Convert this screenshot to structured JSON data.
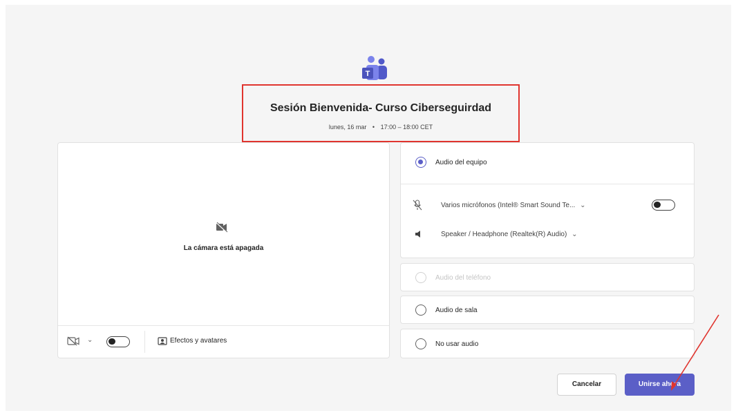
{
  "meeting": {
    "title": "Sesión Bienvenida- Curso Ciberseguirdad",
    "date": "lunes, 16 mar",
    "separator": "•",
    "time": "17:00 – 18:00 CET"
  },
  "video": {
    "camera_off_text": "La cámara está apagada",
    "camera_toggle_on": false,
    "effects_label": "Efectos y avatares"
  },
  "audio": {
    "options": {
      "computer": "Audio del equipo",
      "phone": "Audio del teléfono",
      "room": "Audio de sala",
      "none": "No usar audio"
    },
    "selected": "computer",
    "microphone_label": "Varios micrófonos (Intel® Smart Sound Te...",
    "microphone_on": false,
    "speaker_label": "Speaker / Headphone (Realtek(R) Audio)"
  },
  "buttons": {
    "cancel": "Cancelar",
    "join": "Unirse ahora"
  },
  "colors": {
    "accent": "#5b5fc7",
    "highlight_box": "#e0342e",
    "arrow": "#e0342e"
  },
  "icons": {
    "app_logo": "teams-logo-icon",
    "camera_off": "camera-off-icon",
    "effects": "effects-icon",
    "mic_muted": "mic-off-icon",
    "speaker": "speaker-icon"
  }
}
